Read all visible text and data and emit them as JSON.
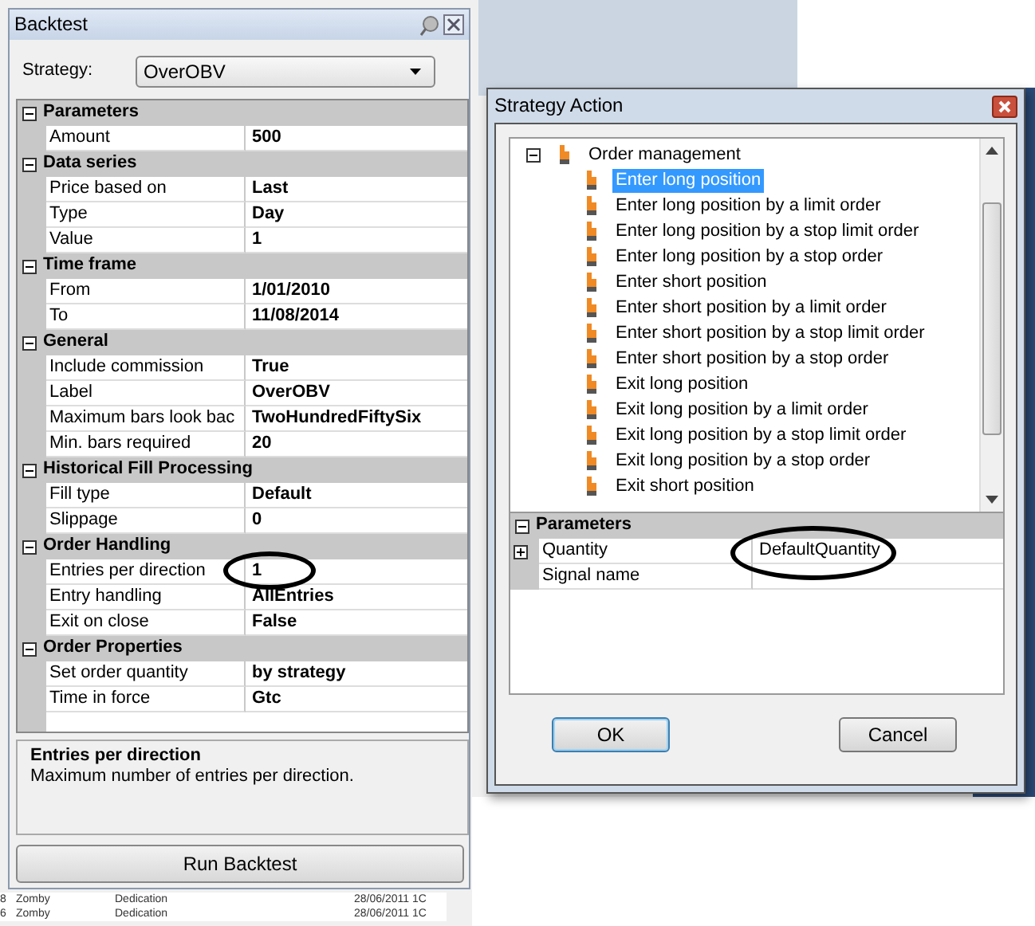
{
  "background_rows": [
    {
      "column_1": "8",
      "artist": "Zomby",
      "title": "Dedication",
      "date": "28/06/2011 1C"
    },
    {
      "column_1": "6",
      "artist": "Zomby",
      "title": "Dedication",
      "date": "28/06/2011 1C"
    }
  ],
  "backtest": {
    "title": "Backtest",
    "strategy_label": "Strategy:",
    "strategy_value": "OverOBV",
    "categories": [
      {
        "name": "Parameters",
        "expanded": true,
        "rows": [
          {
            "label": "Amount",
            "value": "500"
          }
        ]
      },
      {
        "name": "Data series",
        "expanded": true,
        "rows": [
          {
            "label": "Price based on",
            "value": "Last"
          },
          {
            "label": "Type",
            "value": "Day"
          },
          {
            "label": "Value",
            "value": "1"
          }
        ]
      },
      {
        "name": "Time frame",
        "expanded": true,
        "rows": [
          {
            "label": "From",
            "value": "1/01/2010"
          },
          {
            "label": "To",
            "value": "11/08/2014"
          }
        ]
      },
      {
        "name": "General",
        "expanded": true,
        "rows": [
          {
            "label": "Include commission",
            "value": "True"
          },
          {
            "label": "Label",
            "value": "OverOBV"
          },
          {
            "label": "Maximum bars look bac",
            "value": "TwoHundredFiftySix"
          },
          {
            "label": "Min. bars required",
            "value": "20"
          }
        ]
      },
      {
        "name": "Historical Fill Processing",
        "expanded": true,
        "rows": [
          {
            "label": "Fill type",
            "value": "Default"
          },
          {
            "label": "Slippage",
            "value": "0"
          }
        ]
      },
      {
        "name": "Order Handling",
        "expanded": true,
        "rows": [
          {
            "label": "Entries per direction",
            "value": "1",
            "circled": true
          },
          {
            "label": "Entry handling",
            "value": "AllEntries"
          },
          {
            "label": "Exit on close",
            "value": "False"
          }
        ]
      },
      {
        "name": "Order Properties",
        "expanded": true,
        "rows": [
          {
            "label": "Set order quantity",
            "value": "by strategy"
          },
          {
            "label": "Time in force",
            "value": "Gtc"
          }
        ]
      }
    ],
    "description_title": "Entries per direction",
    "description_text": "Maximum number of entries per direction.",
    "run_button": "Run Backtest"
  },
  "strategy_action": {
    "title": "Strategy Action",
    "tree": {
      "label": "Order management",
      "expanded": true,
      "children": [
        {
          "label": "Enter long position",
          "selected": true
        },
        {
          "label": "Enter long position by a limit order",
          "selected": false
        },
        {
          "label": "Enter long position by a stop limit order",
          "selected": false
        },
        {
          "label": "Enter long position by a stop order",
          "selected": false
        },
        {
          "label": "Enter short position",
          "selected": false
        },
        {
          "label": "Enter short position by a limit order",
          "selected": false
        },
        {
          "label": "Enter short position by a stop limit order",
          "selected": false
        },
        {
          "label": "Enter short position by a stop order",
          "selected": false
        },
        {
          "label": "Exit long position",
          "selected": false
        },
        {
          "label": "Exit long position by a limit order",
          "selected": false
        },
        {
          "label": "Exit long position by a stop limit order",
          "selected": false
        },
        {
          "label": "Exit long position by a stop order",
          "selected": false
        },
        {
          "label": "Exit short position",
          "selected": false
        }
      ]
    },
    "parameters": {
      "name": "Parameters",
      "expanded": true,
      "rows": [
        {
          "label": "Quantity",
          "value": "DefaultQuantity",
          "expandable": true,
          "circled": true
        },
        {
          "label": "Signal name",
          "expandable": false
        }
      ]
    },
    "buttons": [
      {
        "label": "OK",
        "default": true
      },
      {
        "label": "Cancel",
        "default": false
      }
    ]
  }
}
